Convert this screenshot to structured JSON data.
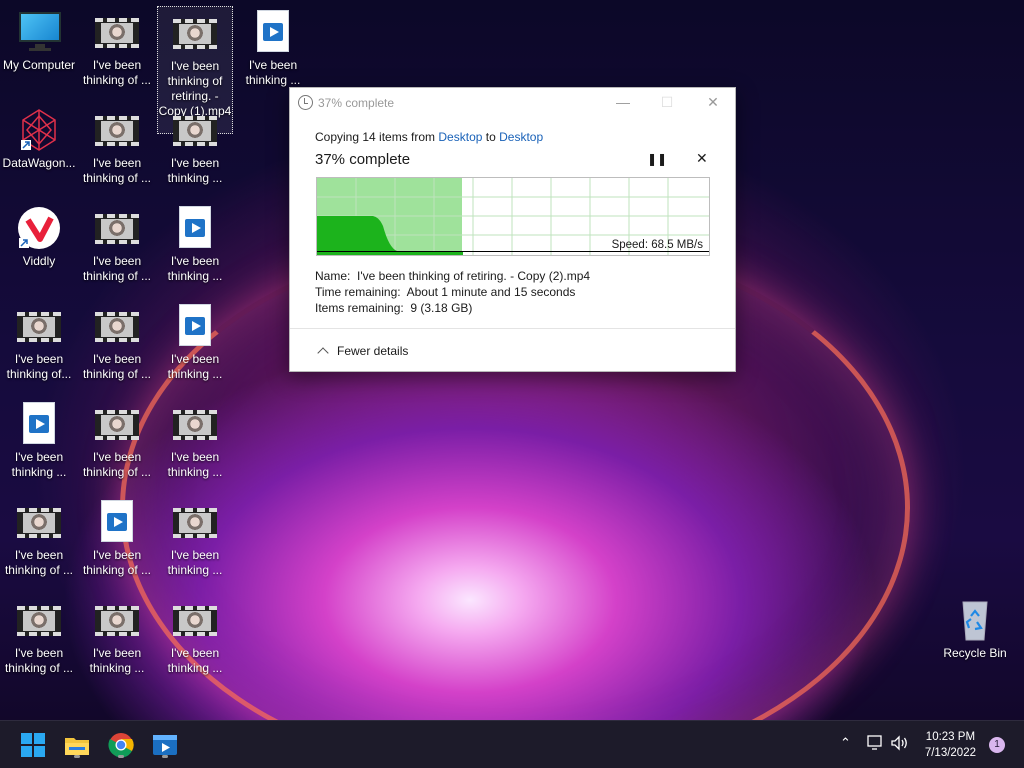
{
  "desktop": {
    "icons": {
      "my_computer": "My Computer",
      "datawagon": "DataWagon...",
      "viddly": "Viddly",
      "recycle_bin": "Recycle Bin",
      "v_thinking_of": "I've been thinking of ...",
      "v_thinking_of_tight": "I've been thinking of...",
      "v_thinking": "I've been thinking ...",
      "selected_full": "I've been thinking of retiring. - Copy (1).mp4"
    }
  },
  "dialog": {
    "title": "37% complete",
    "copy_prefix": "Copying 14 items from ",
    "source": "Desktop",
    "to": " to ",
    "destination": "Desktop",
    "percent_label": "37% complete",
    "progress_fraction": 0.37,
    "speed": "Speed: 68.5 MB/s",
    "name_label": "Name:",
    "name_value": "I've been thinking of retiring. - Copy (2).mp4",
    "time_label": "Time remaining:",
    "time_value": "About 1 minute and 15 seconds",
    "items_label": "Items remaining:",
    "items_value": "9 (3.18 GB)",
    "fewer_details": "Fewer details",
    "buttons": {
      "minimize": "—",
      "maximize": "☐",
      "close": "✕",
      "pause": "❚❚",
      "stop": "✕"
    }
  },
  "taskbar": {
    "clock_time": "10:23 PM",
    "clock_date": "7/13/2022",
    "notification_count": "1",
    "accent": "#0a84ff"
  }
}
